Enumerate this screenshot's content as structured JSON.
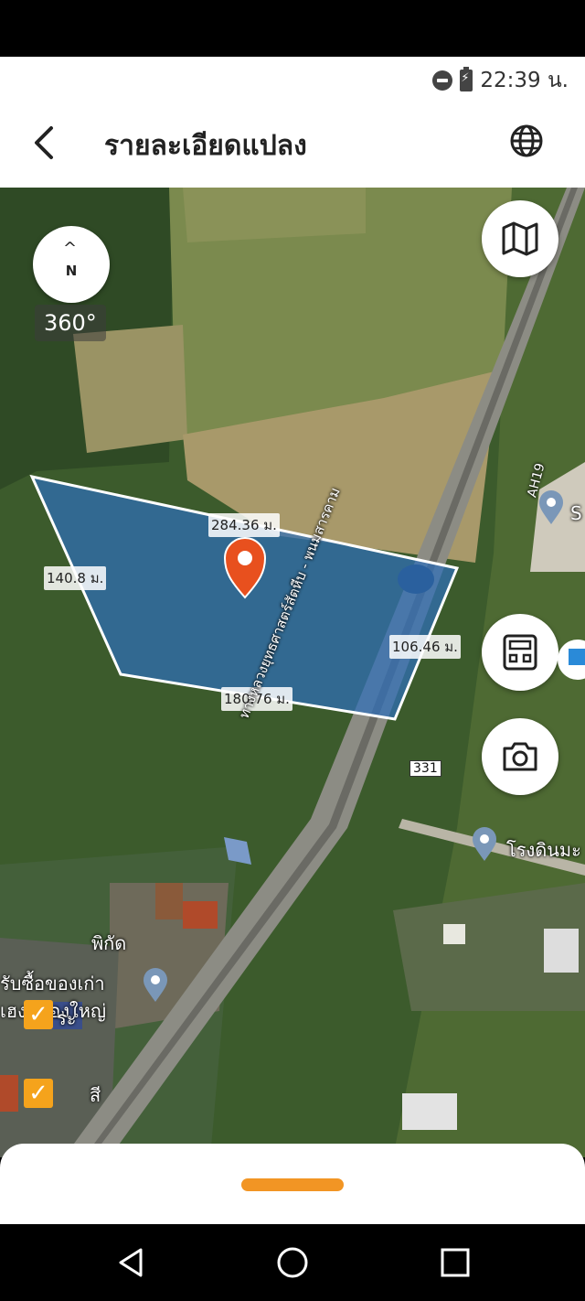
{
  "status_bar": {
    "time": "22:39 น."
  },
  "header": {
    "title": "รายละเอียดแปลง"
  },
  "map": {
    "compass_letter": "N",
    "rotation_label": "360°",
    "plot_edges": {
      "top": "284.36 ม.",
      "left": "140.8 ม.",
      "right": "106.46 ม.",
      "bottom": "180.76 ม."
    },
    "road_route_label": "AH19",
    "road_number_badge": "331",
    "road_name": "ทางหลวงยุทธศาสตร์สัตหีบ - พนมสารคาม",
    "place_label_right": "โรงดินมะ",
    "place_label_s": "S",
    "layer_panel": {
      "title": "พิกัด",
      "shop_label_line1": "รับซื้อของเก่า",
      "shop_label_line2": "เฮงหลองใหญ่",
      "item1_label": "ระ",
      "item2_label": "สี"
    },
    "plot_fill_color": "#2f6fb8",
    "pin_color": "#e8501e"
  },
  "bottom_sheet": {
    "handle_color": "#f29524"
  }
}
